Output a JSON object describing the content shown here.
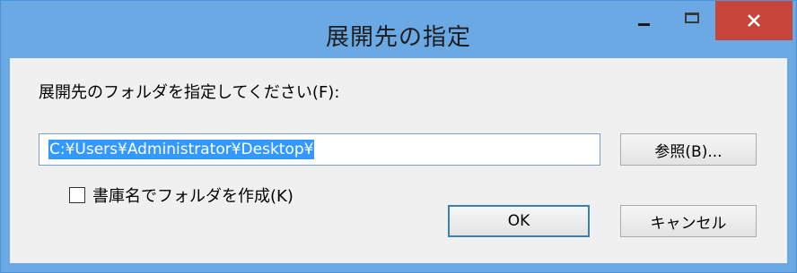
{
  "window": {
    "title": "展開先の指定",
    "close_glyph": "✕"
  },
  "dialog": {
    "prompt": "展開先のフォルダを指定してください(F):",
    "path_value": "C:¥Users¥Administrator¥Desktop¥",
    "browse_label": "参照(B)...",
    "checkbox_label": "書庫名でフォルダを作成(K)",
    "checkbox_checked": false,
    "ok_label": "OK",
    "cancel_label": "キャンセル"
  },
  "colors": {
    "titlebar": "#6aa9e4",
    "close_button": "#c7453a",
    "selection": "#3399ff",
    "client_bg": "#f0f0f0"
  },
  "icons": [
    "minimize-icon",
    "maximize-icon",
    "close-icon"
  ]
}
